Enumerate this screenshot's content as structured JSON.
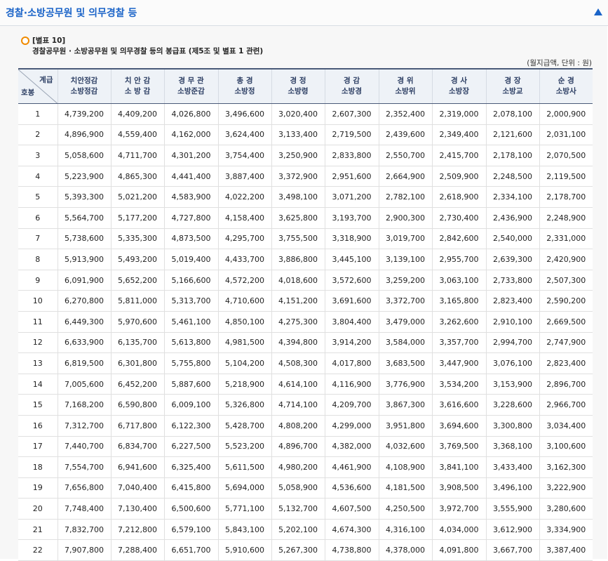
{
  "header": {
    "title": "경찰·소방공무원 및 의무경찰 등"
  },
  "caption": {
    "label": "[별표 10]",
    "subtitle": "경찰공무원 · 소방공무원 및 의무경찰 등의 봉급표 (제5조 및 별표 1 관련)"
  },
  "unit_note": "(월지급액, 단위 : 원)",
  "table": {
    "corner_top": "계급",
    "corner_bottom": "호봉",
    "columns": [
      [
        "치안정감",
        "소방정감"
      ],
      [
        "치 안 감",
        "소 방 감"
      ],
      [
        "경 무 관",
        "소방준감"
      ],
      [
        "총 경",
        "소방정"
      ],
      [
        "경 정",
        "소방령"
      ],
      [
        "경 감",
        "소방경"
      ],
      [
        "경 위",
        "소방위"
      ],
      [
        "경 사",
        "소방장"
      ],
      [
        "경 장",
        "소방교"
      ],
      [
        "순 경",
        "소방사"
      ]
    ],
    "rows": [
      [
        "1",
        "4,739,200",
        "4,409,200",
        "4,026,800",
        "3,496,600",
        "3,020,400",
        "2,607,300",
        "2,352,400",
        "2,319,000",
        "2,078,100",
        "2,000,900"
      ],
      [
        "2",
        "4,896,900",
        "4,559,400",
        "4,162,000",
        "3,624,400",
        "3,133,400",
        "2,719,500",
        "2,439,600",
        "2,349,400",
        "2,121,600",
        "2,031,100"
      ],
      [
        "3",
        "5,058,600",
        "4,711,700",
        "4,301,200",
        "3,754,400",
        "3,250,900",
        "2,833,800",
        "2,550,700",
        "2,415,700",
        "2,178,100",
        "2,070,500"
      ],
      [
        "4",
        "5,223,900",
        "4,865,300",
        "4,441,400",
        "3,887,400",
        "3,372,900",
        "2,951,600",
        "2,664,900",
        "2,509,900",
        "2,248,500",
        "2,119,500"
      ],
      [
        "5",
        "5,393,300",
        "5,021,200",
        "4,583,900",
        "4,022,200",
        "3,498,100",
        "3,071,200",
        "2,782,100",
        "2,618,900",
        "2,334,100",
        "2,178,700"
      ],
      [
        "6",
        "5,564,700",
        "5,177,200",
        "4,727,800",
        "4,158,400",
        "3,625,800",
        "3,193,700",
        "2,900,300",
        "2,730,400",
        "2,436,900",
        "2,248,900"
      ],
      [
        "7",
        "5,738,600",
        "5,335,300",
        "4,873,500",
        "4,295,700",
        "3,755,500",
        "3,318,900",
        "3,019,700",
        "2,842,600",
        "2,540,000",
        "2,331,000"
      ],
      [
        "8",
        "5,913,900",
        "5,493,200",
        "5,019,400",
        "4,433,700",
        "3,886,800",
        "3,445,100",
        "3,139,100",
        "2,955,700",
        "2,639,300",
        "2,420,900"
      ],
      [
        "9",
        "6,091,900",
        "5,652,200",
        "5,166,600",
        "4,572,200",
        "4,018,600",
        "3,572,600",
        "3,259,200",
        "3,063,100",
        "2,733,800",
        "2,507,300"
      ],
      [
        "10",
        "6,270,800",
        "5,811,000",
        "5,313,700",
        "4,710,600",
        "4,151,200",
        "3,691,600",
        "3,372,700",
        "3,165,800",
        "2,823,400",
        "2,590,200"
      ],
      [
        "11",
        "6,449,300",
        "5,970,600",
        "5,461,100",
        "4,850,100",
        "4,275,300",
        "3,804,400",
        "3,479,000",
        "3,262,600",
        "2,910,100",
        "2,669,500"
      ],
      [
        "12",
        "6,633,900",
        "6,135,700",
        "5,613,800",
        "4,981,500",
        "4,394,800",
        "3,914,200",
        "3,584,000",
        "3,357,700",
        "2,994,700",
        "2,747,900"
      ],
      [
        "13",
        "6,819,500",
        "6,301,800",
        "5,755,800",
        "5,104,200",
        "4,508,300",
        "4,017,800",
        "3,683,500",
        "3,447,900",
        "3,076,100",
        "2,823,400"
      ],
      [
        "14",
        "7,005,600",
        "6,452,200",
        "5,887,600",
        "5,218,900",
        "4,614,100",
        "4,116,900",
        "3,776,900",
        "3,534,200",
        "3,153,900",
        "2,896,700"
      ],
      [
        "15",
        "7,168,200",
        "6,590,800",
        "6,009,100",
        "5,326,800",
        "4,714,100",
        "4,209,700",
        "3,867,300",
        "3,616,600",
        "3,228,600",
        "2,966,700"
      ],
      [
        "16",
        "7,312,700",
        "6,717,800",
        "6,122,300",
        "5,428,700",
        "4,808,200",
        "4,299,000",
        "3,951,800",
        "3,694,600",
        "3,300,800",
        "3,034,400"
      ],
      [
        "17",
        "7,440,700",
        "6,834,700",
        "6,227,500",
        "5,523,200",
        "4,896,700",
        "4,382,000",
        "4,032,600",
        "3,769,500",
        "3,368,100",
        "3,100,600"
      ],
      [
        "18",
        "7,554,700",
        "6,941,600",
        "6,325,400",
        "5,611,500",
        "4,980,200",
        "4,461,900",
        "4,108,900",
        "3,841,100",
        "3,433,400",
        "3,162,300"
      ],
      [
        "19",
        "7,656,800",
        "7,040,400",
        "6,415,800",
        "5,694,000",
        "5,058,900",
        "4,536,600",
        "4,181,500",
        "3,908,500",
        "3,496,100",
        "3,222,900"
      ],
      [
        "20",
        "7,748,400",
        "7,130,400",
        "6,500,600",
        "5,771,100",
        "5,132,700",
        "4,607,500",
        "4,250,500",
        "3,972,700",
        "3,555,900",
        "3,280,600"
      ],
      [
        "21",
        "7,832,700",
        "7,212,800",
        "6,579,100",
        "5,843,100",
        "5,202,100",
        "4,674,300",
        "4,316,100",
        "4,034,000",
        "3,612,900",
        "3,334,900"
      ],
      [
        "22",
        "7,907,800",
        "7,288,400",
        "6,651,700",
        "5,910,600",
        "5,267,300",
        "4,738,800",
        "4,378,000",
        "4,091,800",
        "3,667,700",
        "3,387,400"
      ]
    ]
  },
  "icons": {
    "collapse": "triangle-up-icon",
    "bullet": "circle-bullet-icon"
  },
  "colors": {
    "title": "#1b64c8",
    "bullet": "#f08a00",
    "header_bg": "#eef2f7",
    "header_line": "#4a5a78"
  }
}
